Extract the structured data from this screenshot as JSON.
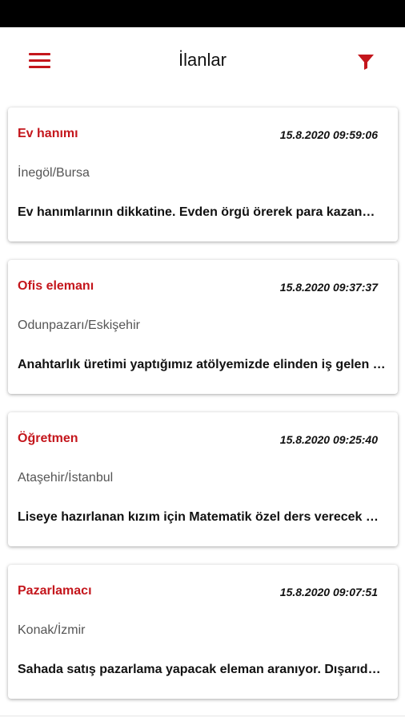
{
  "header": {
    "title": "İlanlar",
    "menu_icon": "hamburger-menu-icon",
    "filter_icon": "funnel-filter-icon",
    "accent_color": "#c4161c"
  },
  "listings": [
    {
      "job": "Ev hanımı",
      "date": "15.8.2020 09:59:06",
      "location": "İnegöl/Bursa",
      "description": "Ev hanımlarının dikkatine. Evden örgü örerek para kazanmak isteyenler için fırsat."
    },
    {
      "job": "Ofis elemanı",
      "date": "15.8.2020 09:37:37",
      "location": "Odunpazarı/Eskişehir",
      "description": "Anahtarlık üretimi yaptığımız atölyemizde elinden iş gelen eleman arıyoruz."
    },
    {
      "job": "Öğretmen",
      "date": "15.8.2020 09:25:40",
      "location": "Ataşehir/İstanbul",
      "description": "Liseye hazırlanan kızım için Matematik özel ders verecek öğretmen arıyorum."
    },
    {
      "job": "Pazarlamacı",
      "date": "15.8.2020 09:07:51",
      "location": "Konak/İzmir",
      "description": "Sahada satış pazarlama yapacak eleman aranıyor. Dışarıda çalışmayı seven."
    }
  ]
}
